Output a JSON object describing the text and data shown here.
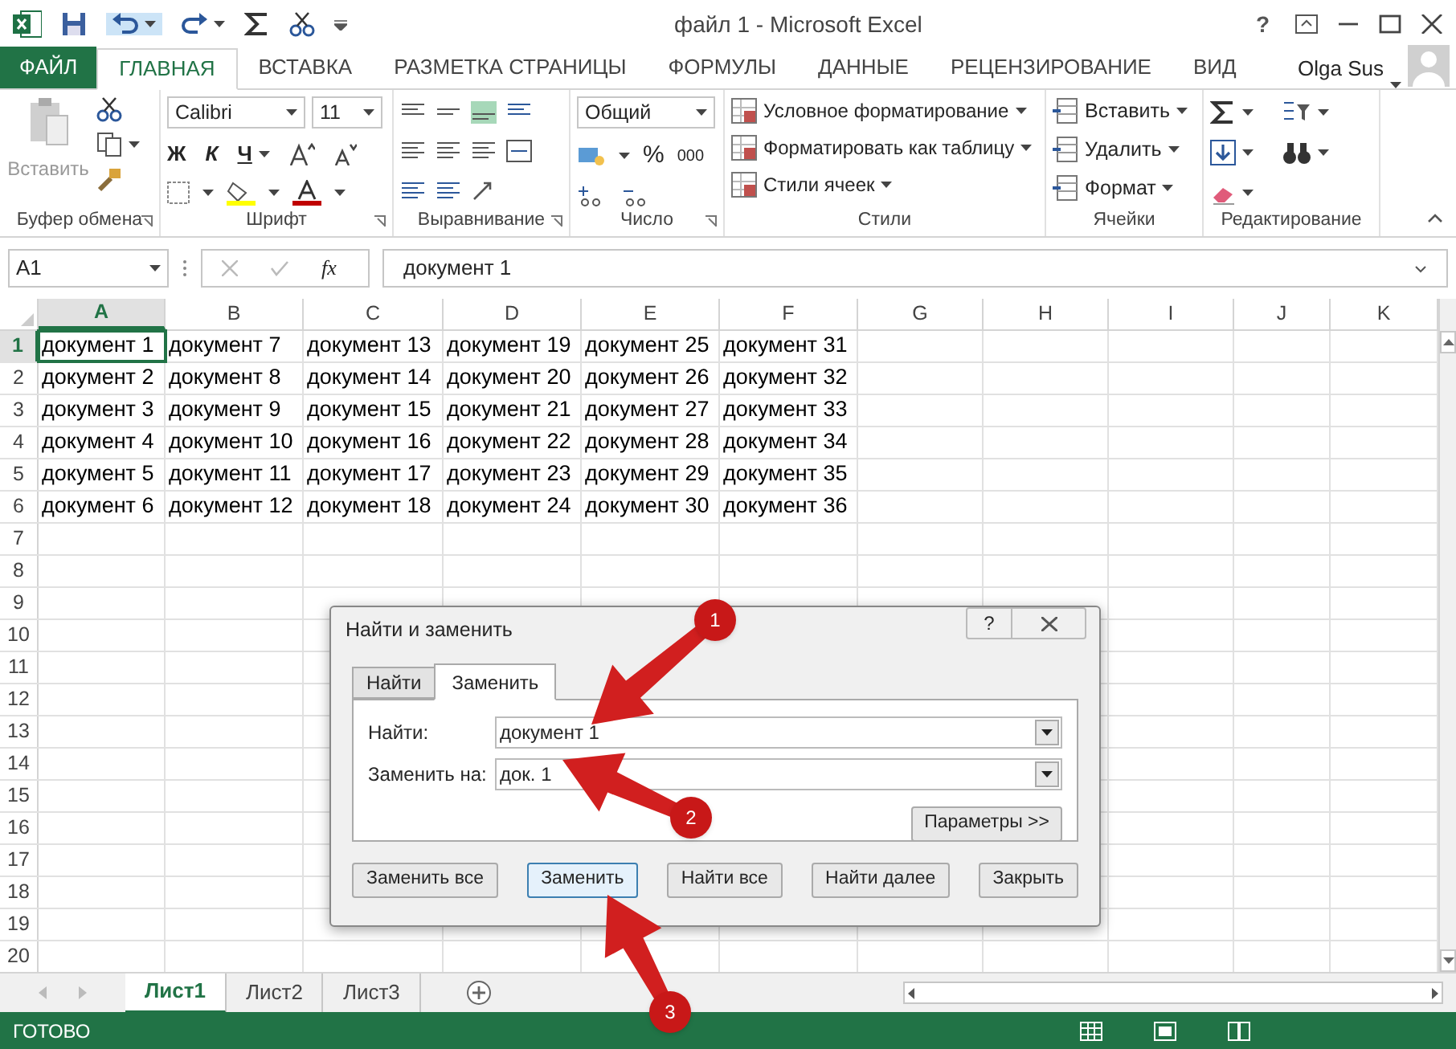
{
  "window": {
    "title": "файл 1 - Microsoft Excel",
    "help": "?"
  },
  "ribbon_tabs": [
    {
      "label": "ФАЙЛ",
      "kind": "file",
      "selected": false
    },
    {
      "label": "ГЛАВНАЯ",
      "kind": "tab",
      "selected": true
    },
    {
      "label": "ВСТАВКА",
      "kind": "tab",
      "selected": false
    },
    {
      "label": "РАЗМЕТКА СТРАНИЦЫ",
      "kind": "tab",
      "selected": false
    },
    {
      "label": "ФОРМУЛЫ",
      "kind": "tab",
      "selected": false
    },
    {
      "label": "ДАННЫЕ",
      "kind": "tab",
      "selected": false
    },
    {
      "label": "РЕЦЕНЗИРОВАНИЕ",
      "kind": "tab",
      "selected": false
    },
    {
      "label": "ВИД",
      "kind": "tab",
      "selected": false
    }
  ],
  "user": "Olga Sus",
  "clipboard": {
    "paste": "Вставить",
    "group": "Буфер обмена"
  },
  "font": {
    "name": "Calibri",
    "size": "11",
    "bold": "Ж",
    "italic": "К",
    "underline": "Ч",
    "group": "Шрифт"
  },
  "alignment": {
    "group": "Выравнивание"
  },
  "number": {
    "format": "Общий",
    "percent": "%",
    "thousands": "000",
    "group": "Число"
  },
  "styles": {
    "items": [
      "Условное форматирование",
      "Форматировать как таблицу",
      "Стили ячеек"
    ],
    "group": "Стили"
  },
  "cells": {
    "items": [
      "Вставить",
      "Удалить",
      "Формат"
    ],
    "group": "Ячейки"
  },
  "editing": {
    "group": "Редактирование"
  },
  "formula_bar": {
    "name_box": "A1",
    "function_symbol": "fx",
    "value": "документ 1"
  },
  "columns": [
    {
      "label": "A",
      "selected": true
    },
    {
      "label": "B",
      "selected": false
    },
    {
      "label": "C",
      "selected": false
    },
    {
      "label": "D",
      "selected": false
    },
    {
      "label": "E",
      "selected": false
    },
    {
      "label": "F",
      "selected": false
    },
    {
      "label": "G",
      "selected": false
    },
    {
      "label": "H",
      "selected": false
    },
    {
      "label": "I",
      "selected": false
    },
    {
      "label": "J",
      "selected": false
    },
    {
      "label": "K",
      "selected": false
    }
  ],
  "rows": [
    {
      "label": "1",
      "selected": true,
      "cells": [
        "документ 1",
        "документ 7",
        "документ 13",
        "документ 19",
        "документ 25",
        "документ 31"
      ]
    },
    {
      "label": "2",
      "selected": false,
      "cells": [
        "документ 2",
        "документ 8",
        "документ 14",
        "документ 20",
        "документ 26",
        "документ 32"
      ]
    },
    {
      "label": "3",
      "selected": false,
      "cells": [
        "документ 3",
        "документ 9",
        "документ 15",
        "документ 21",
        "документ 27",
        "документ 33"
      ]
    },
    {
      "label": "4",
      "selected": false,
      "cells": [
        "документ 4",
        "документ 10",
        "документ 16",
        "документ 22",
        "документ 28",
        "документ 34"
      ]
    },
    {
      "label": "5",
      "selected": false,
      "cells": [
        "документ 5",
        "документ 11",
        "документ 17",
        "документ 23",
        "документ 29",
        "документ 35"
      ]
    },
    {
      "label": "6",
      "selected": false,
      "cells": [
        "документ 6",
        "документ 12",
        "документ 18",
        "документ 24",
        "документ 30",
        "документ 36"
      ]
    },
    {
      "label": "7",
      "selected": false
    },
    {
      "label": "8",
      "selected": false
    },
    {
      "label": "9",
      "selected": false
    },
    {
      "label": "10",
      "selected": false
    },
    {
      "label": "11",
      "selected": false
    },
    {
      "label": "12",
      "selected": false
    },
    {
      "label": "13",
      "selected": false
    },
    {
      "label": "14",
      "selected": false
    },
    {
      "label": "15",
      "selected": false
    },
    {
      "label": "16",
      "selected": false
    },
    {
      "label": "17",
      "selected": false
    },
    {
      "label": "18",
      "selected": false
    },
    {
      "label": "19",
      "selected": false
    },
    {
      "label": "20",
      "selected": false
    }
  ],
  "sheet_tabs": [
    {
      "label": "Лист1",
      "selected": true
    },
    {
      "label": "Лист2",
      "selected": false
    },
    {
      "label": "Лист3",
      "selected": false
    }
  ],
  "status": "ГОТОВО",
  "dialog": {
    "title": "Найти и заменить",
    "help": "?",
    "tabs": [
      {
        "label": "Найти",
        "selected": false
      },
      {
        "label": "Заменить",
        "selected": true
      }
    ],
    "fields": [
      {
        "label": "Найти:",
        "value": "документ 1"
      },
      {
        "label": "Заменить на:",
        "value": "док. 1"
      }
    ],
    "options_button": "Параметры >>",
    "buttons": [
      {
        "label": "Заменить все",
        "focused": false
      },
      {
        "label": "Заменить",
        "focused": true
      },
      {
        "label": "Найти все",
        "focused": false
      },
      {
        "label": "Найти далее",
        "focused": false
      },
      {
        "label": "Закрыть",
        "focused": false
      }
    ]
  },
  "callouts": [
    {
      "number": "1"
    },
    {
      "number": "2"
    },
    {
      "number": "3"
    }
  ]
}
